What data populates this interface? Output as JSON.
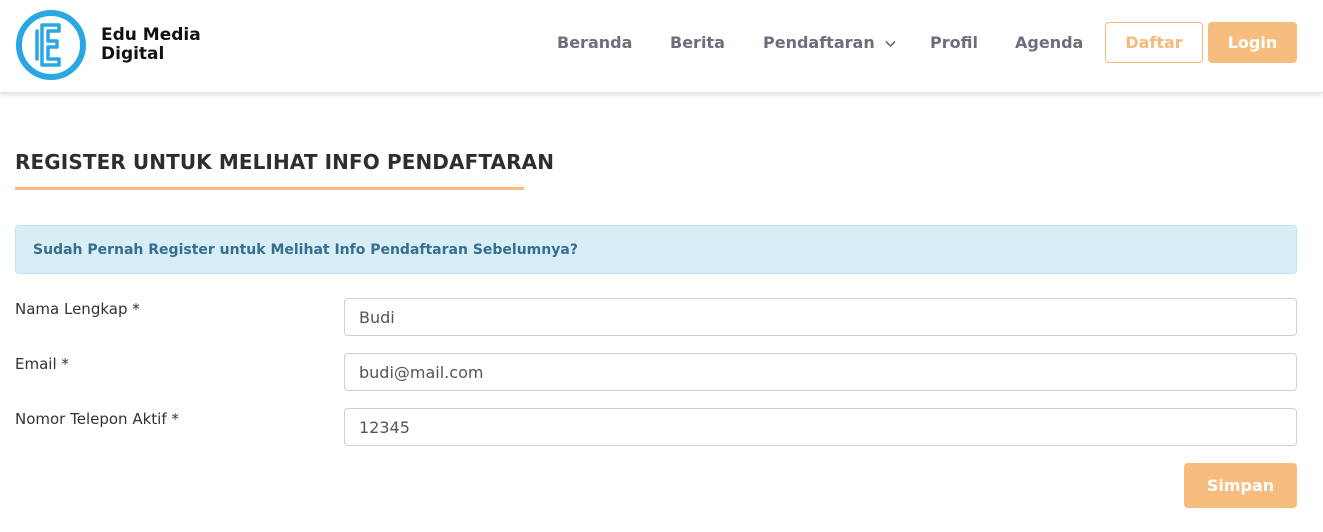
{
  "brand": {
    "line1": "Edu Media",
    "line2": "Digital",
    "logo_icon": "edu-logo-icon",
    "logo_color": "#2aa7e3"
  },
  "nav": {
    "items": [
      {
        "label": "Beranda"
      },
      {
        "label": "Berita"
      },
      {
        "label": "Pendaftaran",
        "icon": "chevron-down-icon"
      },
      {
        "label": "Profil"
      },
      {
        "label": "Agenda"
      }
    ],
    "register_label": "Daftar",
    "login_label": "Login"
  },
  "page": {
    "title": "REGISTER UNTUK MELIHAT INFO PENDAFTARAN",
    "alert": "Sudah Pernah Register untuk Melihat Info Pendaftaran Sebelumnya?"
  },
  "form": {
    "fields": [
      {
        "label": "Nama Lengkap *",
        "value": "Budi"
      },
      {
        "label": "Email *",
        "value": "budi@mail.com"
      },
      {
        "label": "Nomor Telepon Aktif *",
        "value": "12345"
      }
    ],
    "submit_label": "Simpan"
  },
  "colors": {
    "accent": "#f6bd7f",
    "alert_bg": "#d9edf7",
    "alert_text": "#31708f"
  }
}
